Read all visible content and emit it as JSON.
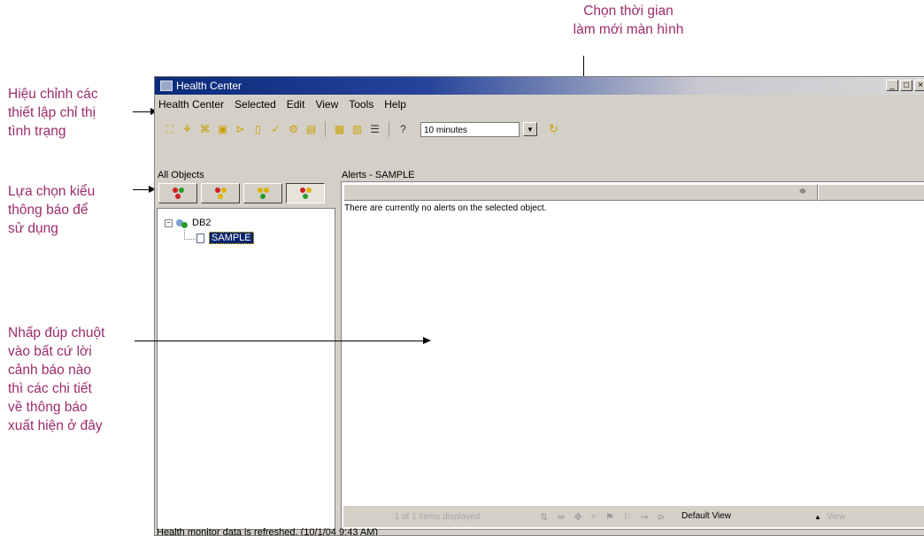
{
  "annotations": {
    "refresh_time": "Chọn thời gian\nlàm mới màn hình",
    "edit_settings": "Hiệu chỉnh các\nthiết lập chỉ thị\ntình trạng",
    "filter_type": "Lựa chọn kiểu\nthông báo để\nsử dụng",
    "double_click": "Nhấp đúp chuột\nvào bất cứ lời\ncảnh báo nào\nthì các chi tiết\nvề thông báo\nxuất hiện ở đây"
  },
  "window": {
    "title": "Health Center",
    "controls": [
      "_",
      "□",
      "×"
    ]
  },
  "menu": [
    "Health Center",
    "Selected",
    "Edit",
    "View",
    "Tools",
    "Help"
  ],
  "toolbar": {
    "icons": [
      "tree-icon",
      "health-icon",
      "tree-alt-icon",
      "monitor-icon",
      "indicator-icon",
      "note-icon",
      "check-icon",
      "config-icon",
      "db-icon",
      "grid-icon",
      "details-icon",
      "list-icon",
      "help-icon"
    ],
    "refresh_interval": "10 minutes"
  },
  "left_pane": {
    "label": "All Objects",
    "filter_buttons": [
      {
        "name": "alarm-filter",
        "colors": [
          "#cc2222",
          "#cc2222",
          "#2a9a2a"
        ]
      },
      {
        "name": "warning-filter",
        "colors": [
          "#cc2222",
          "#d9b400",
          "#2a9a2a"
        ]
      },
      {
        "name": "attention-filter",
        "colors": [
          "#cc2222",
          "#d9b400",
          "#2a9a2a"
        ]
      },
      {
        "name": "all-filter",
        "colors": [
          "#cc2222",
          "#d9b400",
          "#2a9a2a"
        ]
      }
    ],
    "tree": {
      "root": "DB2",
      "child": "SAMPLE"
    }
  },
  "right_pane": {
    "label": "Alerts - SAMPLE",
    "no_alerts": "There are currently no alerts on the selected object.",
    "items_displayed": "1 of 1 items displayed",
    "view": "Default View",
    "view_button": "View"
  },
  "status": "Health monitor data is refreshed. (10/1/04 9:43 AM)"
}
